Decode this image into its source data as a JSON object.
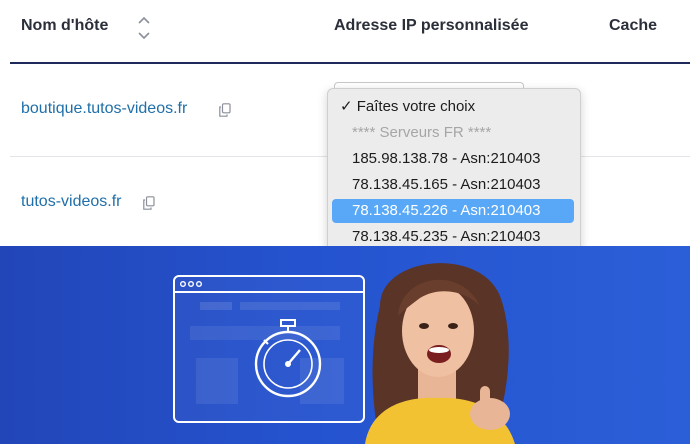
{
  "table": {
    "columns": {
      "host": "Nom d'hôte",
      "ip": "Adresse IP personnalisée",
      "cache": "Cache"
    },
    "rows": [
      {
        "host": "boutique.tutos-videos.fr"
      },
      {
        "host": "tutos-videos.fr"
      }
    ]
  },
  "dropdown": {
    "options": [
      {
        "label": "✓ Faîtes votre choix",
        "state": "selected"
      },
      {
        "label": "**** Serveurs FR ****",
        "state": "disabled"
      },
      {
        "label": "185.98.138.78 - Asn:210403",
        "state": "normal"
      },
      {
        "label": "78.138.45.165 - Asn:210403",
        "state": "normal"
      },
      {
        "label": "78.138.45.226 - Asn:210403",
        "state": "highlighted"
      },
      {
        "label": "78.138.45.235 - Asn:210403",
        "state": "normal"
      }
    ],
    "highlight_color": "#58a8f7"
  },
  "icons": {
    "sort": "sort-arrows-icon",
    "copy": "copy-icon",
    "browser": "browser-window-icon",
    "stopwatch": "stopwatch-icon"
  },
  "colors": {
    "link": "#1f6fa8",
    "banner": "#2553cf",
    "header_rule": "#1e2a5a"
  }
}
